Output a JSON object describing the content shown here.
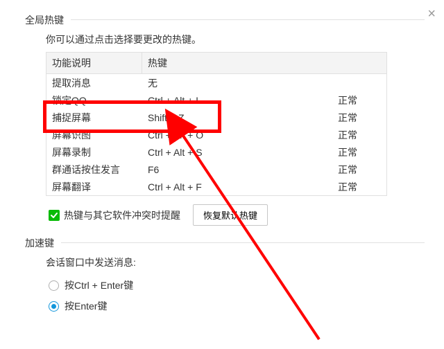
{
  "close_label": "×",
  "global": {
    "legend": "全局热键",
    "desc": "你可以通过点击选择要更改的热键。",
    "headers": {
      "name": "功能说明",
      "key": "热键"
    },
    "rows": [
      {
        "name": "提取消息",
        "key": "无",
        "status": ""
      },
      {
        "name": "锁定QQ",
        "key": "Ctrl + Alt + L",
        "status": "正常"
      },
      {
        "name": "捕捉屏幕",
        "key": "Shift + Z",
        "status": "正常"
      },
      {
        "name": "屏幕识图",
        "key": "Ctrl + Alt + O",
        "status": "正常"
      },
      {
        "name": "屏幕录制",
        "key": "Ctrl + Alt + S",
        "status": "正常"
      },
      {
        "name": "群通话按住发言",
        "key": "F6",
        "status": "正常"
      },
      {
        "name": "屏幕翻译",
        "key": "Ctrl + Alt + F",
        "status": "正常"
      }
    ],
    "conflict_label": "热键与其它软件冲突时提醒",
    "reset_label": "恢复默认热键"
  },
  "accel": {
    "legend": "加速键",
    "send_label": "会话窗口中发送消息:",
    "opt1": "按Ctrl + Enter键",
    "opt2": "按Enter键"
  }
}
